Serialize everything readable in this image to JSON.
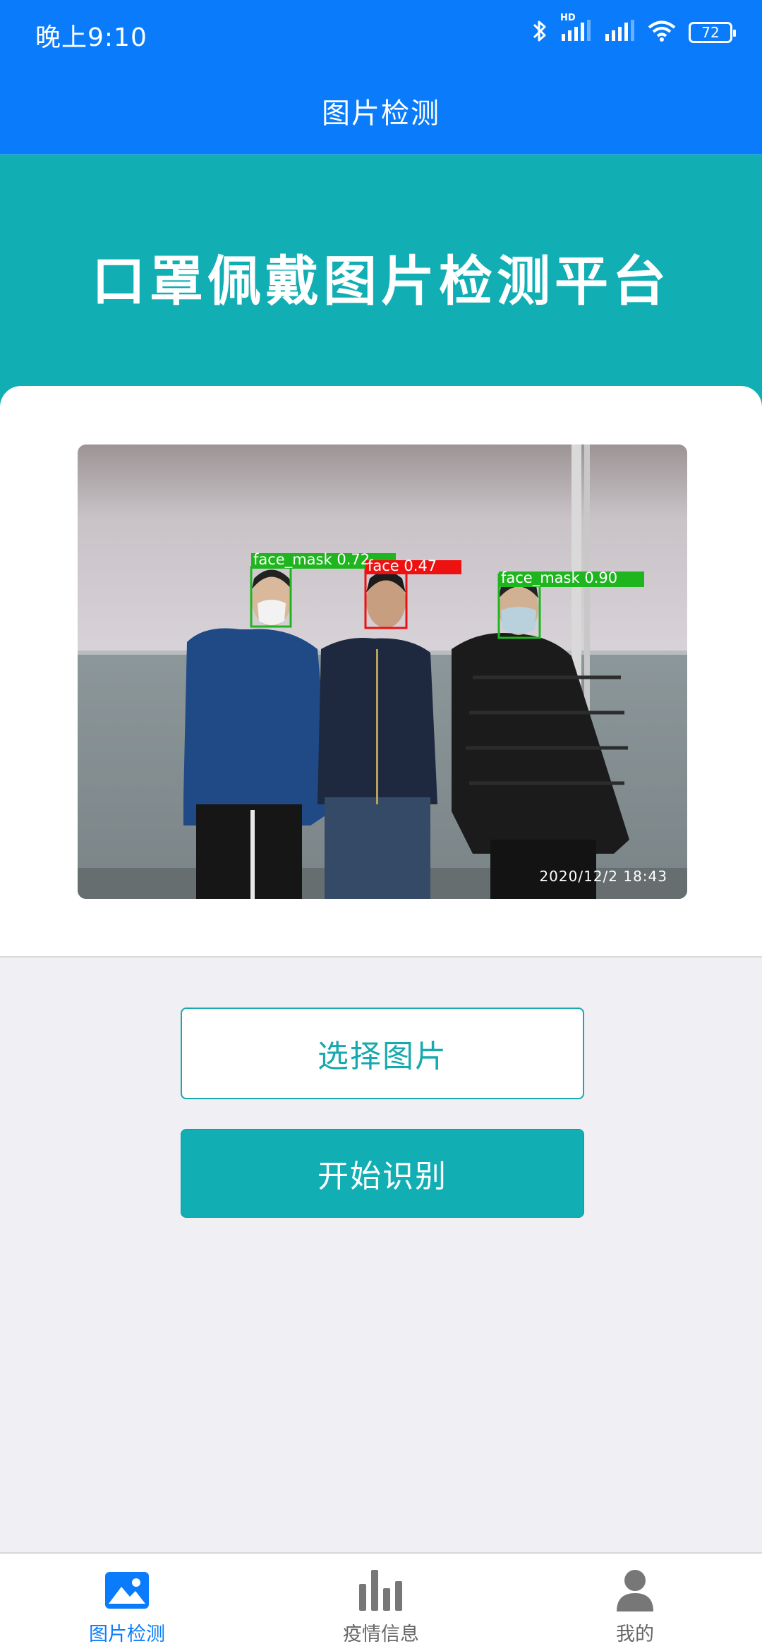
{
  "status_bar": {
    "time": "晚上9:10",
    "battery": "72",
    "network_label": "HD",
    "icons": [
      "bluetooth-icon",
      "signal-hd-icon",
      "signal-icon",
      "wifi-icon",
      "battery-icon"
    ]
  },
  "navbar": {
    "title": "图片检测"
  },
  "hero": {
    "title": "口罩佩戴图片检测平台"
  },
  "photo": {
    "detections": [
      {
        "label": "face_mask 0.72",
        "color": "#1fb51f"
      },
      {
        "label": "face 0.47",
        "color": "#ee1111"
      },
      {
        "label": "face_mask 0.90",
        "color": "#1fb51f"
      }
    ],
    "timestamp": "2020/12/2 18:43"
  },
  "actions": {
    "select_label": "选择图片",
    "start_label": "开始识别"
  },
  "tabs": [
    {
      "label": "图片检测",
      "icon": "image-icon",
      "active": true
    },
    {
      "label": "疫情信息",
      "icon": "bar-chart-icon",
      "active": false
    },
    {
      "label": "我的",
      "icon": "person-icon",
      "active": false
    }
  ],
  "colors": {
    "primary_blue": "#0a7cfb",
    "teal": "#11aeb4",
    "background": "#efeff4"
  }
}
